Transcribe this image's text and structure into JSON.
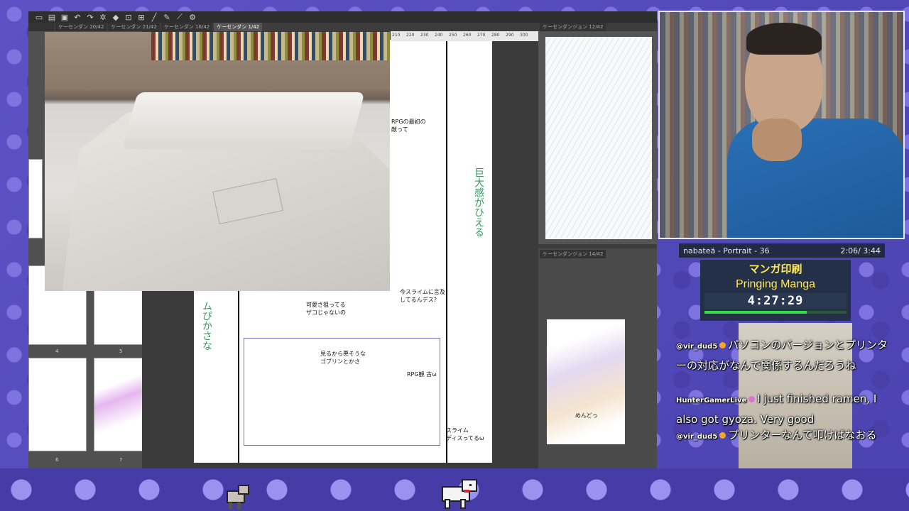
{
  "app": {
    "tabs": [
      "ケーセンダン 20/42",
      "ケーセンダン 21/42",
      "ケーセンダン 16/42",
      "ケーセンダン 1/42"
    ],
    "active_tab_index": 3,
    "right_doc_tab": "ケーセンダンジョン 12/42",
    "right_doc2_tab": "ケーセンダンジョン 14/42",
    "thumb_numbers": [
      "4",
      "5",
      "6",
      "7"
    ],
    "ruler_labels": [
      "210",
      "220",
      "230",
      "240",
      "250",
      "260",
      "270",
      "280",
      "290",
      "300"
    ]
  },
  "sketch": {
    "bubble1": "RPGの最初の\n敵って",
    "bubble2": "今スライムに言及\nしてるんデス?",
    "bubble3": "可愛さ狙ってる\nザコじゃないの",
    "bubble4": "見るから悪そうな\nゴブリンとかさ",
    "bubble5": "RPG観 古ω",
    "bottom_note": "スライム\nディスってるω",
    "green_vertical": "巨大感がひえる",
    "green_left": "ムぴかさな",
    "mini_note": "めんどっ"
  },
  "stream": {
    "song_title": "nabateä - Portrait - 36",
    "song_time": "2:06/ 3:44",
    "title_jp": "マンガ印刷",
    "title_en": "Pringing Manga",
    "timer": "4:27:29",
    "timer_progress": 0.72
  },
  "chat": [
    {
      "user": "@vir_dud5",
      "badge": "orange",
      "message": "パソコンのバージョンとプリンターの対応がなんで関係するんだろうね"
    },
    {
      "user": "HunterGamerLive",
      "badge": "pink",
      "message": "I just finished ramen, I also got gyoza. Very good"
    },
    {
      "user": "@vir_dud5",
      "badge": "orange",
      "message": "プリンターなんて叩けばなおる"
    }
  ],
  "colors": {
    "accent_timer": "#33dd44",
    "title_yellow": "#ffe95a",
    "background": "#5a4fc0"
  }
}
